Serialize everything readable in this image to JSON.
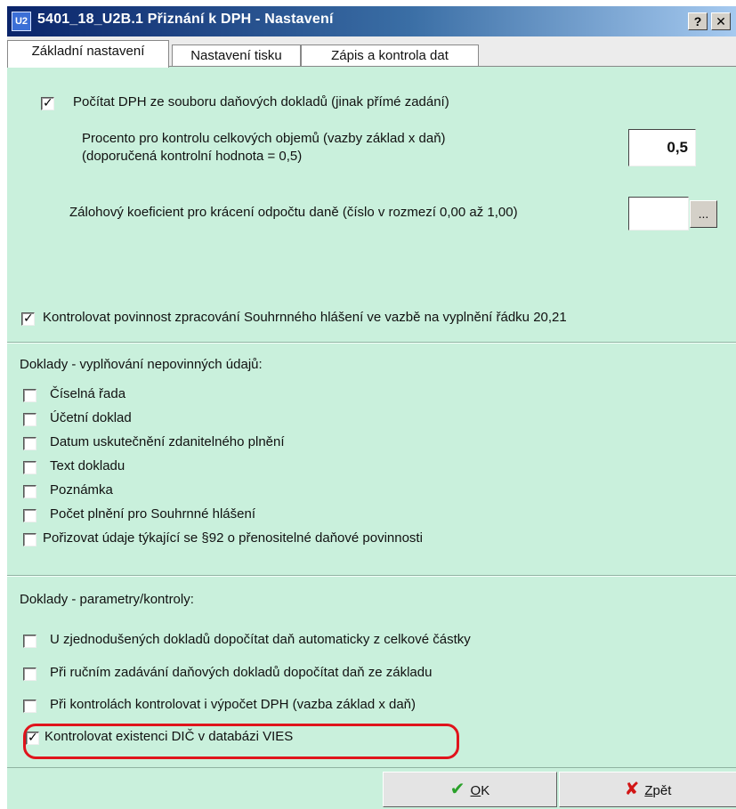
{
  "window": {
    "title": "5401_18_U2B.1 Přiznání k DPH - Nastavení",
    "app_icon": "U2",
    "help_button": "?",
    "close_button": "✕"
  },
  "tabs": [
    {
      "label": "Základní nastavení",
      "active": true
    },
    {
      "label": "Nastavení tisku",
      "active": false
    },
    {
      "label": "Zápis a kontrola dat",
      "active": false
    }
  ],
  "general": {
    "calc_from_docs": {
      "label": "Počítat DPH ze souboru daňových dokladů (jinak přímé zadání)",
      "checked": true
    },
    "percent_label_1": "Procento pro kontrolu celkových objemů (vazby základ x daň)",
    "percent_label_2": "(doporučená kontrolní hodnota = 0,5)",
    "percent_value": "0,5",
    "coef_label": "Zálohový koeficient pro krácení odpočtu daně (číslo v rozmezí 0,00 až 1,00)",
    "coef_value": "",
    "coef_button": "...",
    "summary_check": {
      "label": "Kontrolovat povinnost zpracování Souhrnného hlášení ve vazbě na vyplnění řádku 20,21",
      "checked": true
    }
  },
  "optional": {
    "heading": "Doklady - vyplňování nepovinných údajů:",
    "items": [
      {
        "label": "Číselná řada",
        "checked": false
      },
      {
        "label": "Účetní doklad",
        "checked": false
      },
      {
        "label": "Datum uskutečnění zdanitelného plnění",
        "checked": false
      },
      {
        "label": "Text dokladu",
        "checked": false
      },
      {
        "label": "Poznámka",
        "checked": false
      },
      {
        "label": "Počet plnění pro Souhrnné hlášení",
        "checked": false
      },
      {
        "label": "Pořizovat údaje týkající se §92 o přenositelné daňové povinnosti",
        "checked": false
      }
    ]
  },
  "params": {
    "heading": "Doklady - parametry/kontroly:",
    "items": [
      {
        "label": "U zjednodušených dokladů dopočítat daň automaticky z celkové částky",
        "checked": false
      },
      {
        "label": "Při ručním zadávání daňových dokladů dopočítat daň ze základu",
        "checked": false
      },
      {
        "label": "Při kontrolách kontrolovat i výpočet DPH (vazba základ x daň)",
        "checked": false
      },
      {
        "label": "Kontrolovat existenci DIČ v databázi VIES",
        "checked": true
      }
    ]
  },
  "footer": {
    "ok_mnemonic": "O",
    "ok_rest": "K",
    "back_mnemonic": "Z",
    "back_rest": "pět"
  },
  "colors": {
    "panel_bg": "#c9f0dc",
    "highlight": "#e0141c",
    "title_bar": "#0a246a"
  },
  "icons": {
    "ok": "check-icon",
    "back": "x-icon",
    "checkbox_mark": "✓"
  }
}
